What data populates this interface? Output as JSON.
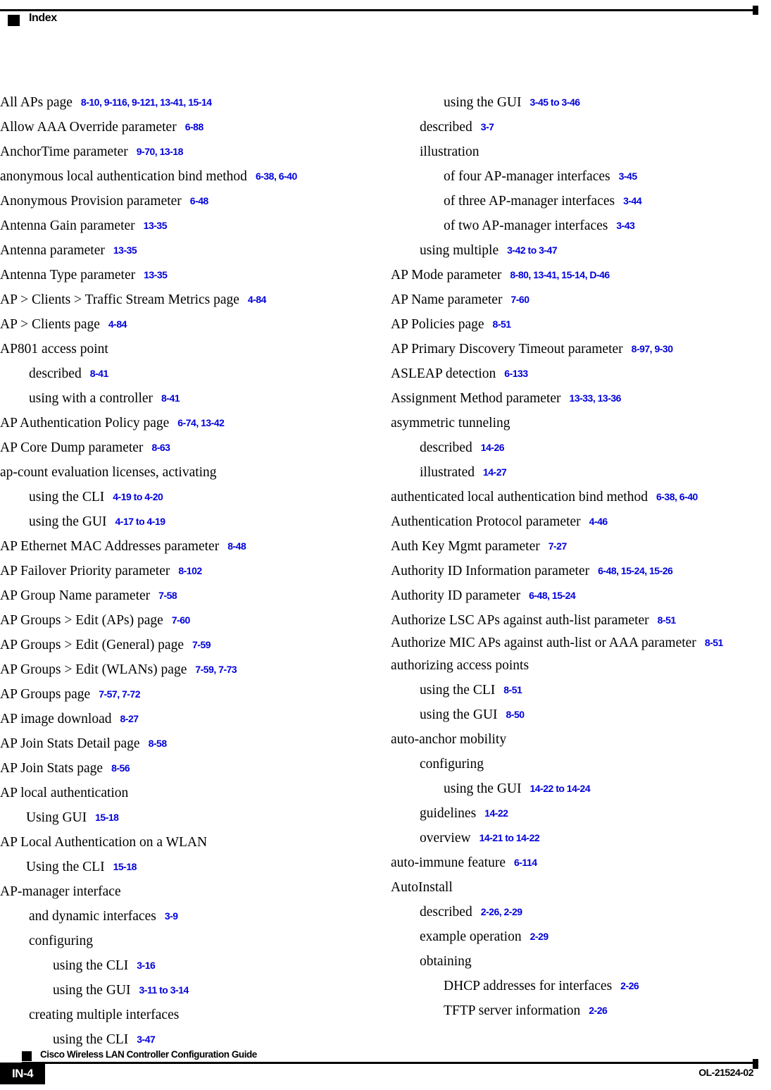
{
  "header": {
    "title": "Index"
  },
  "footer": {
    "guide_title": "Cisco Wireless LAN Controller Configuration Guide",
    "page_number": "IN-4",
    "doc_id": "OL-21524-02"
  },
  "columns": {
    "left": [
      {
        "level": 0,
        "term": "All APs page",
        "locators": "8-10, 9-116, 9-121, 13-41, 15-14"
      },
      {
        "level": 0,
        "term": "Allow AAA Override parameter",
        "locators": "6-88"
      },
      {
        "level": 0,
        "term": "AnchorTime parameter",
        "locators": "9-70, 13-18"
      },
      {
        "level": 0,
        "term": "anonymous local authentication bind method",
        "locators": "6-38, 6-40"
      },
      {
        "level": 0,
        "term": "Anonymous Provision parameter",
        "locators": "6-48"
      },
      {
        "level": 0,
        "term": "Antenna Gain parameter",
        "locators": "13-35"
      },
      {
        "level": 0,
        "term": "Antenna parameter",
        "locators": "13-35"
      },
      {
        "level": 0,
        "term": "Antenna Type parameter",
        "locators": "13-35"
      },
      {
        "level": 0,
        "term": "AP > Clients > Traffic Stream Metrics page",
        "locators": "4-84"
      },
      {
        "level": 0,
        "term": "AP > Clients page",
        "locators": "4-84"
      },
      {
        "level": 0,
        "term": "AP801 access point",
        "locators": ""
      },
      {
        "level": 1,
        "term": "described",
        "locators": "8-41"
      },
      {
        "level": 1,
        "term": "using with a controller",
        "locators": "8-41"
      },
      {
        "level": 0,
        "term": "AP Authentication Policy page",
        "locators": "6-74, 13-42"
      },
      {
        "level": 0,
        "term": "AP Core Dump parameter",
        "locators": "8-63"
      },
      {
        "level": 0,
        "term": "ap-count evaluation licenses, activating",
        "locators": ""
      },
      {
        "level": 1,
        "term": "using the CLI",
        "locators": "4-19 to 4-20"
      },
      {
        "level": 1,
        "term": "using the GUI",
        "locators": "4-17 to 4-19"
      },
      {
        "level": 0,
        "term": "AP Ethernet MAC Addresses parameter",
        "locators": "8-48"
      },
      {
        "level": 0,
        "term": "AP Failover Priority parameter",
        "locators": "8-102"
      },
      {
        "level": 0,
        "term": "AP Group Name parameter",
        "locators": "7-58"
      },
      {
        "level": 0,
        "term": "AP Groups > Edit (APs) page",
        "locators": "7-60"
      },
      {
        "level": 0,
        "term": "AP Groups > Edit (General) page",
        "locators": "7-59"
      },
      {
        "level": 0,
        "term": "AP Groups > Edit (WLANs) page",
        "locators": "7-59, 7-73"
      },
      {
        "level": 0,
        "term": "AP Groups page",
        "locators": "7-57, 7-72"
      },
      {
        "level": 0,
        "term": "AP image download",
        "locators": "8-27"
      },
      {
        "level": 0,
        "term": "AP Join Stats Detail page",
        "locators": "8-58"
      },
      {
        "level": 0,
        "term": "AP Join Stats page",
        "locators": "8-56"
      },
      {
        "level": 0,
        "term": "AP local authentication",
        "locators": ""
      },
      {
        "level": 1,
        "term": "Using GUI",
        "locators": "15-18"
      },
      {
        "level": 0,
        "term": "AP Local Authentication on a WLAN",
        "locators": ""
      },
      {
        "level": 1,
        "term": "Using the CLI",
        "locators": "15-18"
      },
      {
        "level": 0,
        "term": "AP-manager interface",
        "locators": ""
      },
      {
        "level": 1,
        "term": "and dynamic interfaces",
        "locators": "3-9"
      },
      {
        "level": 1,
        "term": "configuring",
        "locators": ""
      },
      {
        "level": 2,
        "term": "using the CLI",
        "locators": "3-16"
      },
      {
        "level": 2,
        "term": "using the GUI",
        "locators": "3-11 to 3-14"
      },
      {
        "level": 1,
        "term": "creating multiple interfaces",
        "locators": ""
      },
      {
        "level": 2,
        "term": "using the CLI",
        "locators": "3-47"
      }
    ],
    "right": [
      {
        "level": 2,
        "term": "using the GUI",
        "locators": "3-45 to 3-46"
      },
      {
        "level": 1,
        "term": "described",
        "locators": "3-7"
      },
      {
        "level": 1,
        "term": "illustration",
        "locators": ""
      },
      {
        "level": 2,
        "term": "of four AP-manager interfaces",
        "locators": "3-45"
      },
      {
        "level": 2,
        "term": "of three AP-manager interfaces",
        "locators": "3-44"
      },
      {
        "level": 2,
        "term": "of two AP-manager interfaces",
        "locators": "3-43"
      },
      {
        "level": 1,
        "term": "using multiple",
        "locators": "3-42 to 3-47"
      },
      {
        "level": 0,
        "term": "AP Mode parameter",
        "locators": "8-80, 13-41, 15-14, D-46"
      },
      {
        "level": 0,
        "term": "AP Name parameter",
        "locators": "7-60"
      },
      {
        "level": 0,
        "term": "AP Policies page",
        "locators": "8-51"
      },
      {
        "level": 0,
        "term": "AP Primary Discovery Timeout parameter",
        "locators": "8-97, 9-30"
      },
      {
        "level": 0,
        "term": "ASLEAP detection",
        "locators": "6-133"
      },
      {
        "level": 0,
        "term": "Assignment Method parameter",
        "locators": "13-33, 13-36"
      },
      {
        "level": 0,
        "term": "asymmetric tunneling",
        "locators": ""
      },
      {
        "level": 1,
        "term": "described",
        "locators": "14-26"
      },
      {
        "level": 1,
        "term": "illustrated",
        "locators": "14-27"
      },
      {
        "level": 0,
        "term": "authenticated local authentication bind method",
        "locators": "6-38, 6-40"
      },
      {
        "level": 0,
        "term": "Authentication Protocol parameter",
        "locators": "4-46"
      },
      {
        "level": 0,
        "term": "Auth Key Mgmt parameter",
        "locators": "7-27"
      },
      {
        "level": 0,
        "term": "Authority ID Information parameter",
        "locators": "6-48, 15-24, 15-26"
      },
      {
        "level": 0,
        "term": "Authority ID parameter",
        "locators": "6-48, 15-24"
      },
      {
        "level": 0,
        "term": "Authorize LSC APs against auth-list parameter",
        "locators": "8-51"
      },
      {
        "level": 0,
        "term": "Authorize MIC APs against auth-list or AAA parameter",
        "locators": "8-51",
        "wrap": true
      },
      {
        "level": 0,
        "term": "authorizing access points",
        "locators": ""
      },
      {
        "level": 1,
        "term": "using the CLI",
        "locators": "8-51"
      },
      {
        "level": 1,
        "term": "using the GUI",
        "locators": "8-50"
      },
      {
        "level": 0,
        "term": "auto-anchor mobility",
        "locators": ""
      },
      {
        "level": 1,
        "term": "configuring",
        "locators": ""
      },
      {
        "level": 2,
        "term": "using the GUI",
        "locators": "14-22 to 14-24"
      },
      {
        "level": 1,
        "term": "guidelines",
        "locators": "14-22"
      },
      {
        "level": 1,
        "term": "overview",
        "locators": "14-21 to 14-22"
      },
      {
        "level": 0,
        "term": "auto-immune feature",
        "locators": "6-114"
      },
      {
        "level": 0,
        "term": "AutoInstall",
        "locators": ""
      },
      {
        "level": 1,
        "term": "described",
        "locators": "2-26, 2-29"
      },
      {
        "level": 1,
        "term": "example operation",
        "locators": "2-29"
      },
      {
        "level": 1,
        "term": "obtaining",
        "locators": ""
      },
      {
        "level": 2,
        "term": "DHCP addresses for interfaces",
        "locators": "2-26"
      },
      {
        "level": 2,
        "term": "TFTP server information",
        "locators": "2-26"
      }
    ]
  },
  "colors": {
    "locator_blue": "#0000DD",
    "text_black": "#000000"
  }
}
